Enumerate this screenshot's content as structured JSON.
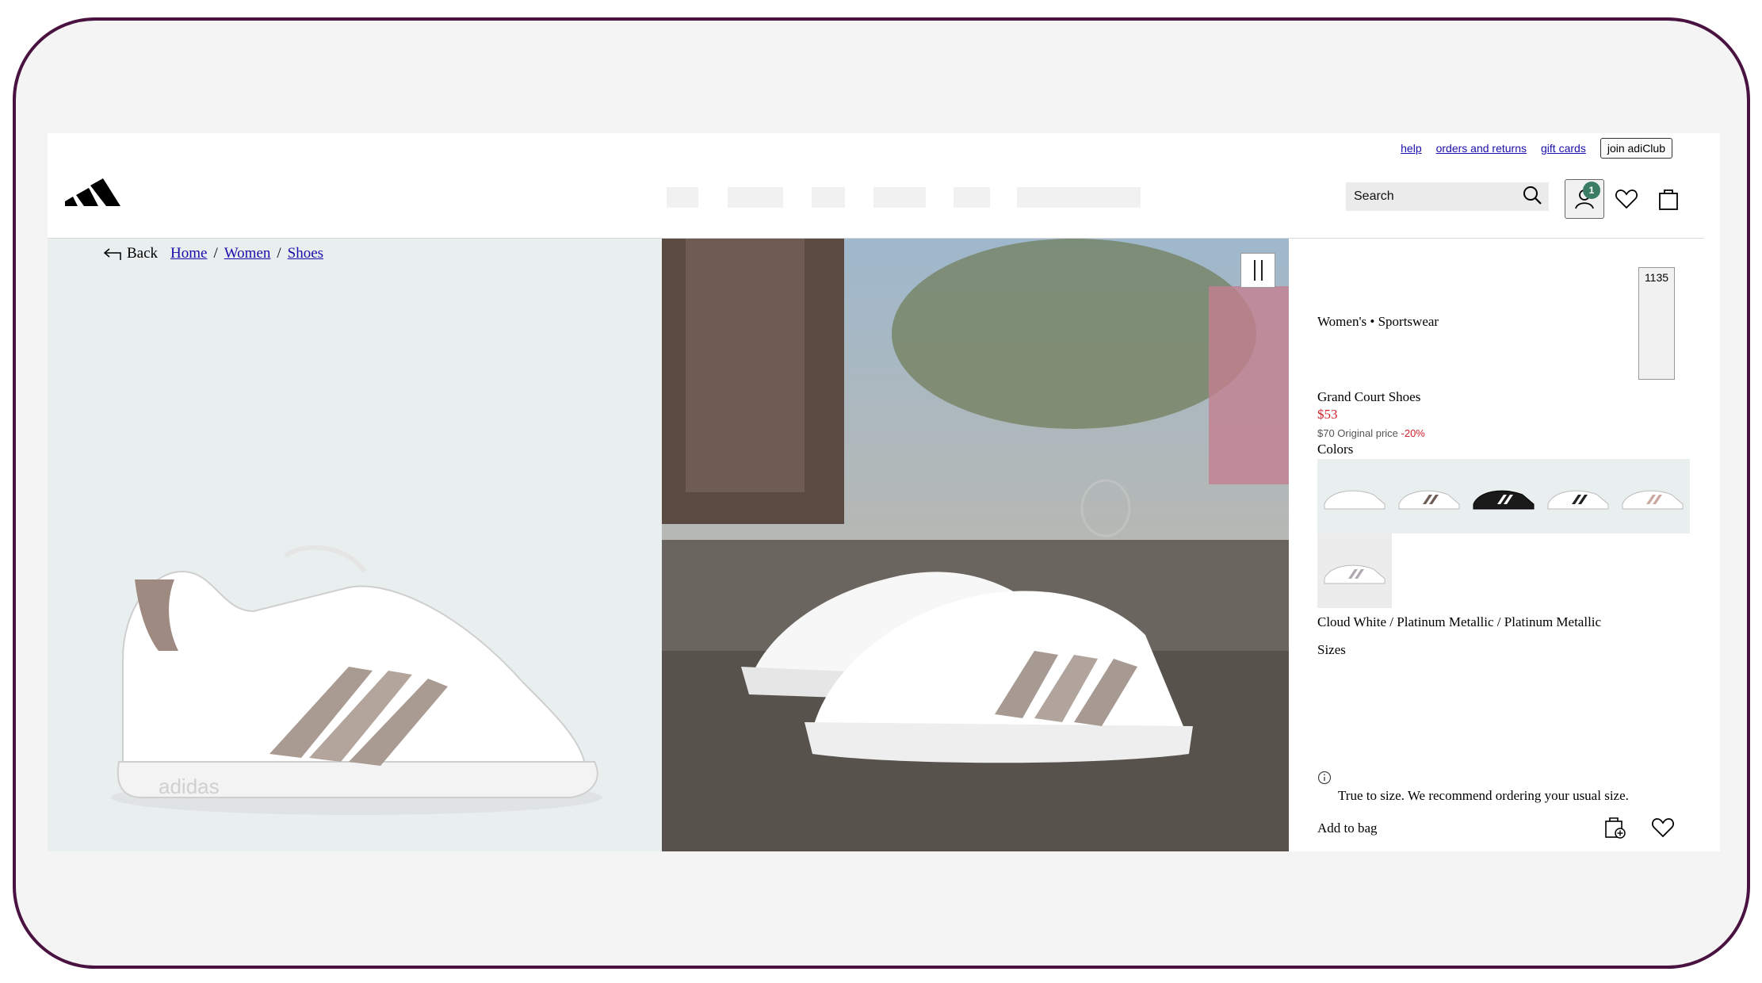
{
  "utility": {
    "help": "help",
    "orders": "orders and returns",
    "gift": "gift cards",
    "join": "join adiClub"
  },
  "header": {
    "search_placeholder": "Search",
    "account_badge": "1"
  },
  "breadcrumb": {
    "back": "Back",
    "home": "Home",
    "sep": "/",
    "women": "Women",
    "shoes": "Shoes"
  },
  "product": {
    "counter": "1135",
    "category": "Women's • Sportswear",
    "name": "Grand Court Shoes",
    "price": "$53",
    "original_price": "$70 Original price",
    "discount": "-20%",
    "colors_label": "Colors",
    "color_name": "Cloud White / Platinum Metallic / Platinum Metallic",
    "sizes_label": "Sizes",
    "fit_note": "True to size. We recommend ordering your usual size.",
    "add_to_bag": "Add to bag",
    "swatch_colors": [
      "#ffffff",
      "#8a7a72",
      "#1a1a1a",
      "#3a3a3a",
      "#c9a9a0",
      "#c8c4cc"
    ]
  },
  "colors": {
    "frame_border": "#4a1240",
    "price_red": "#d0202a",
    "badge_green": "#3a7d63",
    "link_blue": "#1a0dab"
  }
}
